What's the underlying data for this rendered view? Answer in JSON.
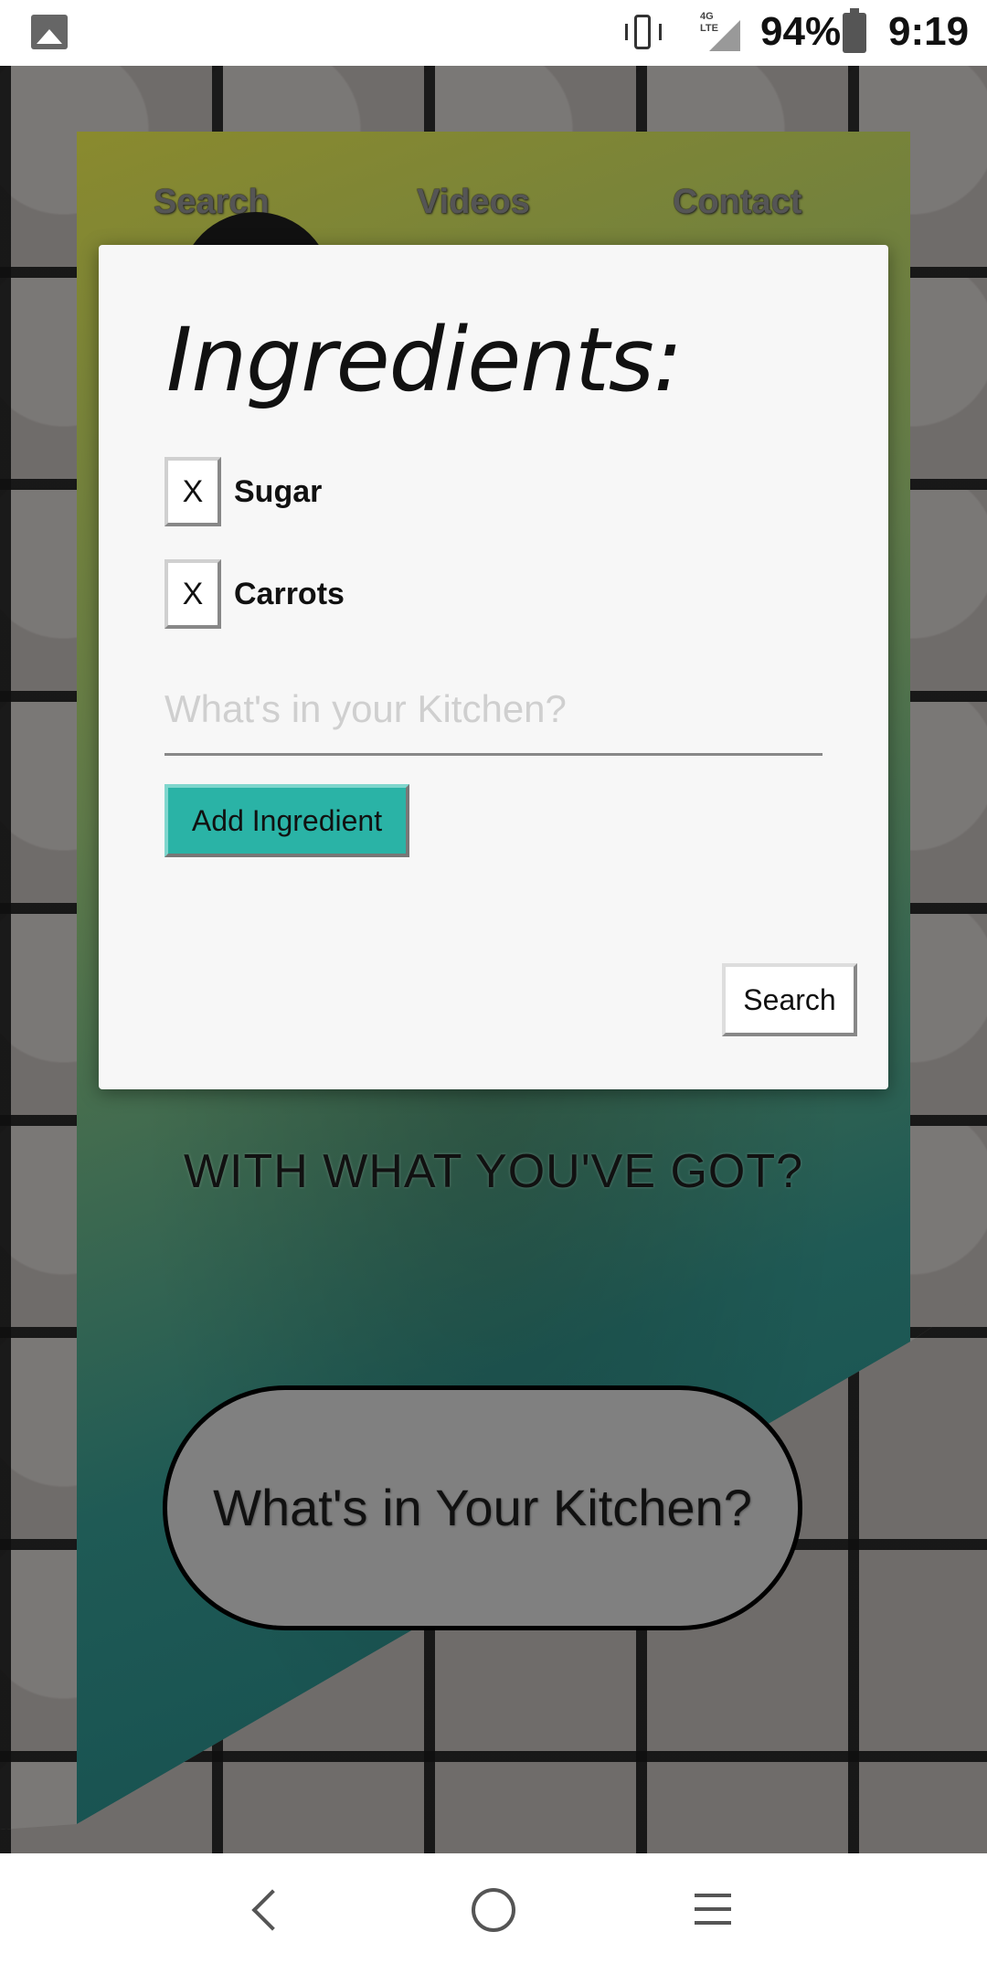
{
  "status_bar": {
    "battery_percent": "94%",
    "time": "9:19",
    "network": "4G LTE",
    "icons": [
      "photo-icon",
      "vibrate-icon",
      "signal-icon",
      "battery-icon"
    ]
  },
  "nav": {
    "items": [
      "Search",
      "Videos",
      "Contact"
    ]
  },
  "hero": {
    "headline": "WITH WHAT YOU'VE GOT?",
    "cta_label": "What's in Your Kitchen?"
  },
  "modal": {
    "title": "Ingredients:",
    "ingredients": [
      {
        "remove_label": "X",
        "name": "Sugar"
      },
      {
        "remove_label": "X",
        "name": "Carrots"
      }
    ],
    "input_placeholder": "What's in your Kitchen?",
    "input_value": "",
    "add_button": "Add Ingredient",
    "search_button": "Search"
  },
  "colors": {
    "accent": "#2ab3a6",
    "modal_bg": "#f7f7f7"
  },
  "system_nav": {
    "icons": [
      "back-icon",
      "home-icon",
      "menu-icon"
    ]
  }
}
